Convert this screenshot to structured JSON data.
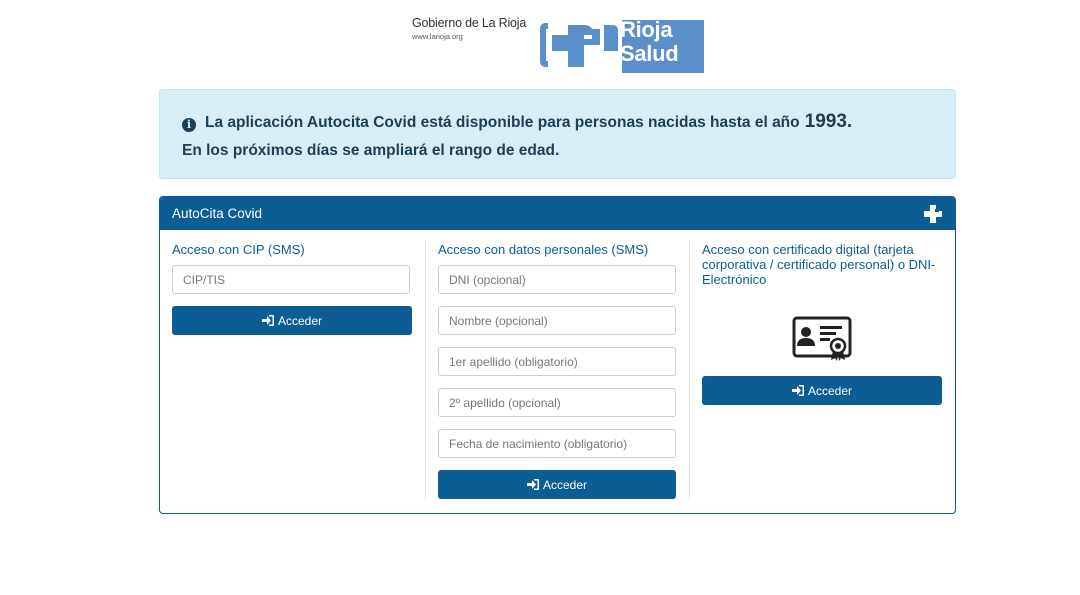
{
  "header": {
    "gov_name": "Gobierno de La Rioja",
    "gov_url": "www.larioja.org",
    "brand_line1": "Rioja",
    "brand_line2": "Salud",
    "brand_color": "#5b8fc9"
  },
  "alert": {
    "icon": "info-circle-icon",
    "line1": "La aplicación Autocita Covid está disponible para personas nacidas hasta el año",
    "year": "1993.",
    "line2": "En los próximos días se ampliará el rango de edad."
  },
  "panel": {
    "title": "AutoCita Covid",
    "icon": "cross-icon",
    "cip": {
      "title": "Acceso con CIP (SMS)",
      "placeholder": "CIP/TIS",
      "button_label": "Acceder"
    },
    "personal": {
      "title": "Acceso con datos personales (SMS)",
      "dni_placeholder": "DNI (opcional)",
      "name_placeholder": "Nombre (opcional)",
      "surname1_placeholder": "1er apellido (obligatorio)",
      "surname2_placeholder": "2º apellido (opcional)",
      "birthdate_placeholder": "Fecha de nacimiento (obligatorio)",
      "button_label": "Acceder"
    },
    "certificate": {
      "title": "Acceso con certificado digital (tarjeta corporativa / certificado personal) o DNI-Electrónico",
      "icon": "digital-certificate-icon",
      "button_label": "Acceder"
    }
  },
  "colors": {
    "primary": "#0b5d93",
    "alert_bg": "#d9edf7",
    "alert_text": "#1d3f55"
  }
}
